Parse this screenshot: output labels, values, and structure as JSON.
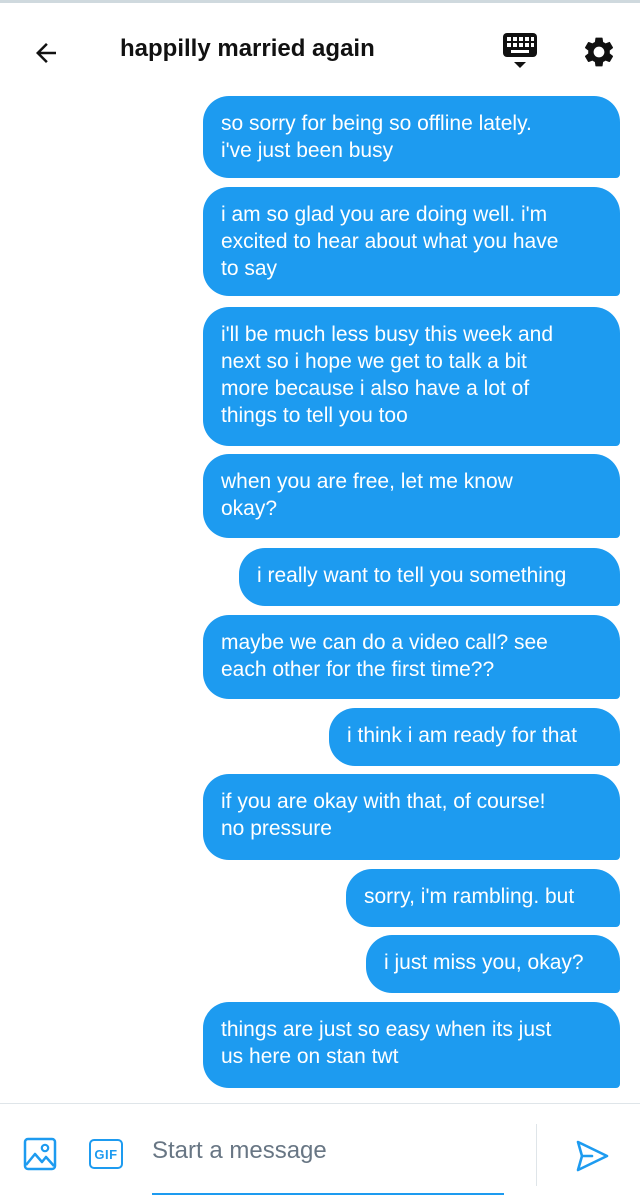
{
  "header": {
    "title": "happilly married again",
    "back_icon": "arrow-left-icon",
    "keyboard_icon": "keyboard-icon",
    "settings_icon": "gear-icon"
  },
  "messages": [
    {
      "text": "so sorry for being so offline lately.\ni've just been busy"
    },
    {
      "text": "i am so glad you are doing well. i'm\nexcited to hear about what you have\nto say"
    },
    {
      "text": "i'll be much less busy this week and\nnext so i hope we get to talk a bit\nmore because i also have a lot of\nthings to tell you too"
    },
    {
      "text": "when you are free, let me know\nokay?"
    },
    {
      "text": "i really want to tell you something"
    },
    {
      "text": "maybe we can do a video call? see\neach other for the first time??"
    },
    {
      "text": "i think i am ready for that"
    },
    {
      "text": "if you are okay with that, of course!\nno pressure"
    },
    {
      "text": "sorry, i'm rambling. but"
    },
    {
      "text": "i just miss you, okay?"
    },
    {
      "text": "things are just so easy when its just\nus here on stan twt"
    }
  ],
  "composer": {
    "placeholder": "Start a message",
    "gif_label": "GIF",
    "media_icon": "image-icon",
    "send_icon": "send-icon"
  },
  "colors": {
    "accent": "#1d9bf0",
    "bubble_text": "#ffffff",
    "title_text": "#111111",
    "placeholder": "#687684"
  }
}
